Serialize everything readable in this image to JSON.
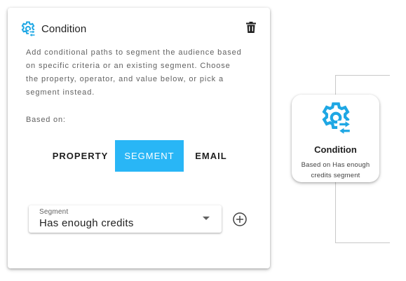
{
  "panel": {
    "title": "Condition",
    "icon": "gear-arrows-icon",
    "delete_icon": "trash-icon",
    "description": "Add conditional paths to segment the audience based on specific criteria or an existing segment. Choose the property, operator, and value below, or pick a segment instead.",
    "based_on_label": "Based on:",
    "toggles": [
      {
        "label": "Property",
        "selected": false
      },
      {
        "label": "Segment",
        "selected": true
      },
      {
        "label": "Email",
        "selected": false
      }
    ],
    "select": {
      "label": "Segment",
      "value": "Has enough credits"
    },
    "add_icon": "plus-circle-icon"
  },
  "node": {
    "title": "Condition",
    "subtitle": "Based on Has enough credits segment"
  },
  "colors": {
    "accent": "#29b6f6",
    "icon_blue": "#1ea7e4",
    "connector": "#c8c8c8"
  }
}
